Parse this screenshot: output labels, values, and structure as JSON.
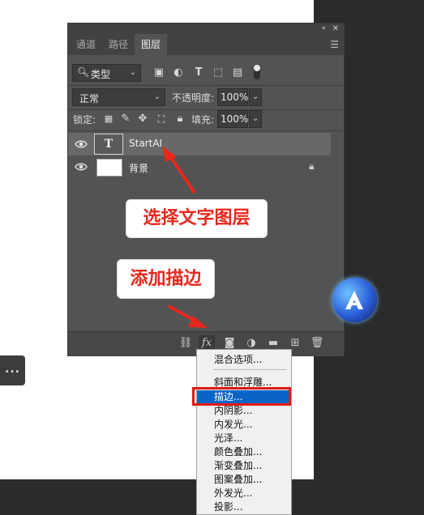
{
  "panel": {
    "tabs": [
      {
        "label": "通道",
        "active": false
      },
      {
        "label": "路径",
        "active": false
      },
      {
        "label": "图层",
        "active": true
      }
    ],
    "filter": {
      "label": "类型"
    },
    "blend_mode": "正常",
    "opacity": {
      "label": "不透明度:",
      "value": "100%"
    },
    "lock": {
      "label": "锁定:"
    },
    "fill": {
      "label": "填充:",
      "value": "100%"
    },
    "layers": [
      {
        "name": "StartAI",
        "type": "text",
        "visible": true,
        "selected": true,
        "thumb_text": "T"
      },
      {
        "name": "背景",
        "type": "image",
        "visible": true,
        "selected": false,
        "locked": true
      }
    ],
    "bottom_icons": [
      "link-icon",
      "fx-icon",
      "mask-icon",
      "adjustment-icon",
      "group-icon",
      "new-layer-icon",
      "trash-icon"
    ],
    "fx_label": "fx"
  },
  "annotations": {
    "select_text_layer": "选择文字图层",
    "add_stroke": "添加描边"
  },
  "fx_menu": {
    "items": [
      "混合选项...",
      "斜面和浮雕...",
      "描边...",
      "内阴影...",
      "内发光...",
      "光泽...",
      "颜色叠加...",
      "渐变叠加...",
      "图案叠加...",
      "外发光...",
      "投影..."
    ],
    "selected": "描边..."
  },
  "more_button": "...",
  "colors": {
    "panel": "#535353",
    "accent_red": "#e8281d",
    "menu_selected": "#0a64c8"
  }
}
